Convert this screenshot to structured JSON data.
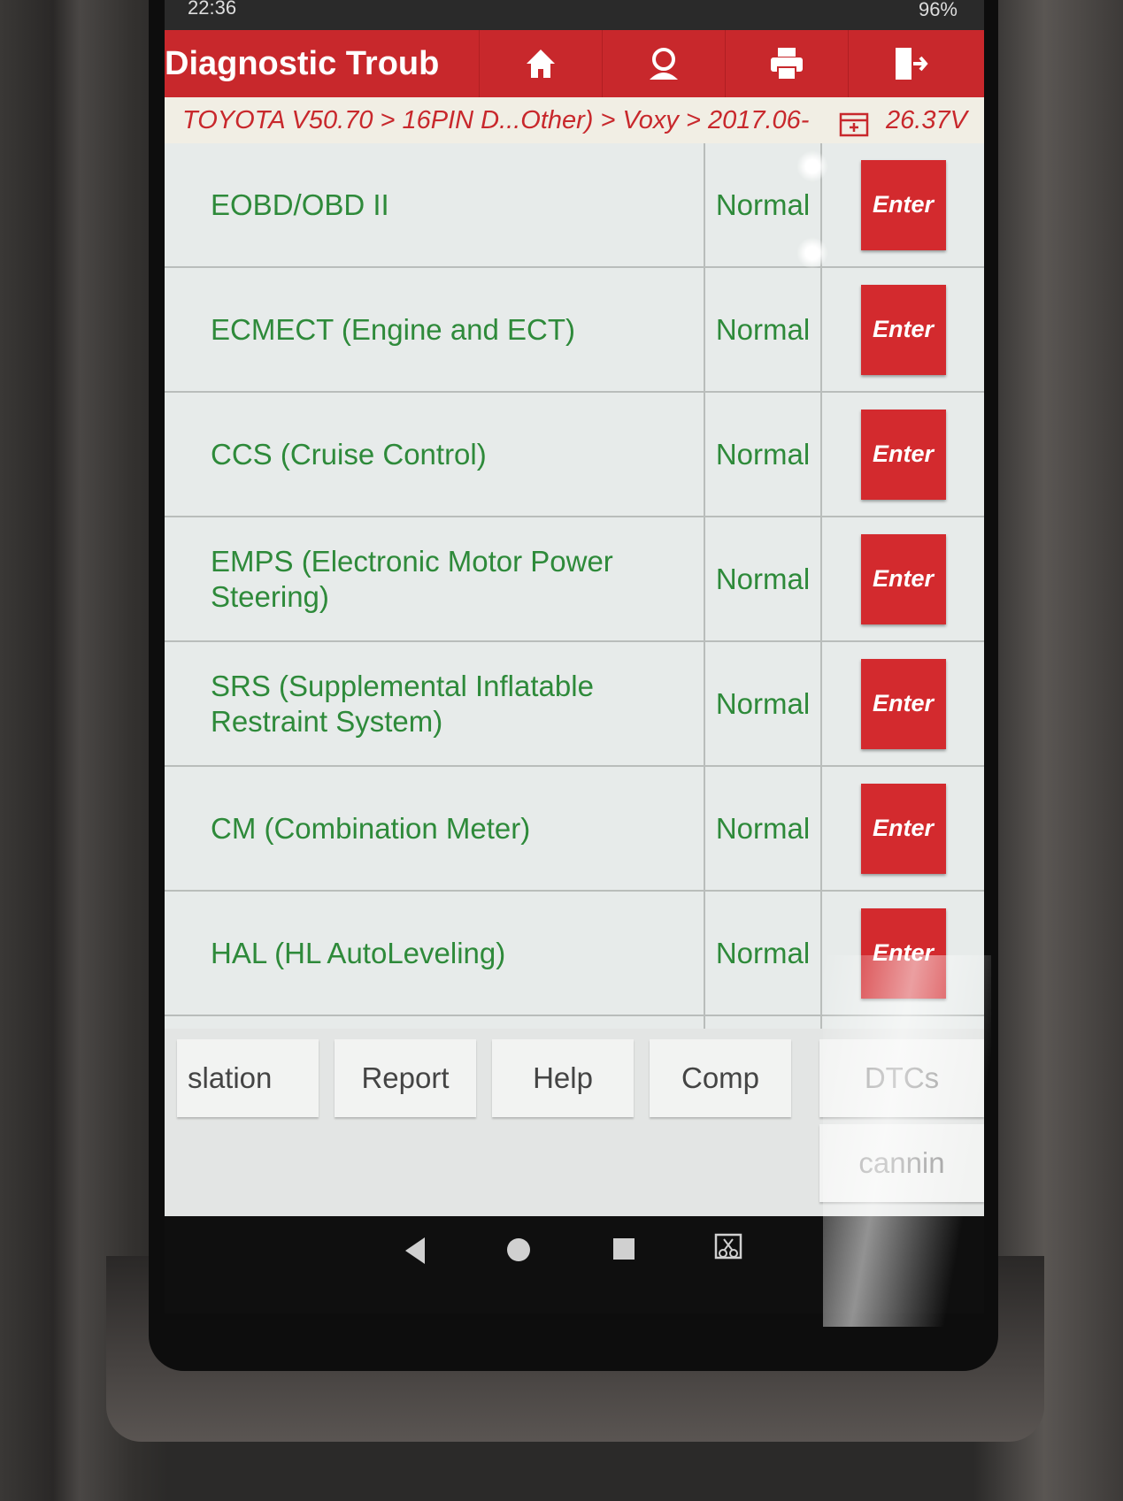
{
  "status_bar": {
    "time": "22:36",
    "battery": "96%"
  },
  "header": {
    "title": "Diagnostic Troub",
    "icons": [
      "home-icon",
      "support-icon",
      "print-icon",
      "exit-icon"
    ]
  },
  "breadcrumb": {
    "path": "TOYOTA V50.70 > 16PIN D...Other) > Voxy > 2017.06-",
    "voltage": "26.37V"
  },
  "systems": [
    {
      "name": "EOBD/OBD II",
      "status": "Normal",
      "action": "Enter"
    },
    {
      "name": "ECMECT (Engine and ECT)",
      "status": "Normal",
      "action": "Enter"
    },
    {
      "name": "CCS (Cruise Control)",
      "status": "Normal",
      "action": "Enter"
    },
    {
      "name": "EMPS (Electronic Motor Power Steering)",
      "status": "Normal",
      "action": "Enter"
    },
    {
      "name": "SRS (Supplemental Inflatable Restraint System)",
      "status": "Normal",
      "action": "Enter"
    },
    {
      "name": "CM (Combination Meter)",
      "status": "Normal",
      "action": "Enter"
    },
    {
      "name": "HAL (HL AutoLeveling)",
      "status": "Normal",
      "action": "Enter"
    }
  ],
  "toolbar": {
    "translation": "slation",
    "report": "Report",
    "help": "Help",
    "comp": "Comp",
    "dtcs": "DTCs",
    "scanning": "cannin"
  },
  "colors": {
    "header": "#c8282c",
    "status_text": "#2e8a3a",
    "enter_button": "#d32a2e"
  }
}
